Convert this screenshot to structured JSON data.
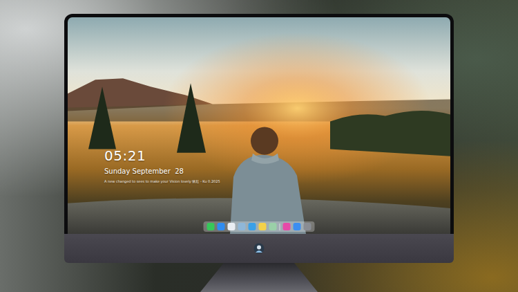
{
  "lock_screen": {
    "time": "05:21",
    "date": "Sunday September  28",
    "caption": "A new changed to sees to make your Vision lovely 缘起 - Ku 0.2025"
  },
  "dock": [
    {
      "kind": "app",
      "color": "#37c85a"
    },
    {
      "kind": "app",
      "color": "#2f8cf0"
    },
    {
      "kind": "app",
      "color": "#e9eef3"
    },
    {
      "kind": "app",
      "color": "#8fb7d8"
    },
    {
      "kind": "app",
      "color": "#3aa0e8"
    },
    {
      "kind": "app",
      "color": "#f3d14a"
    },
    {
      "kind": "app",
      "color": "#9ad0a8"
    },
    {
      "kind": "divider",
      "color": "#ffffff"
    },
    {
      "kind": "app",
      "color": "#e64aa8"
    },
    {
      "kind": "app",
      "color": "#3c8ef0"
    },
    {
      "kind": "app",
      "color": "#8a8d94"
    }
  ]
}
